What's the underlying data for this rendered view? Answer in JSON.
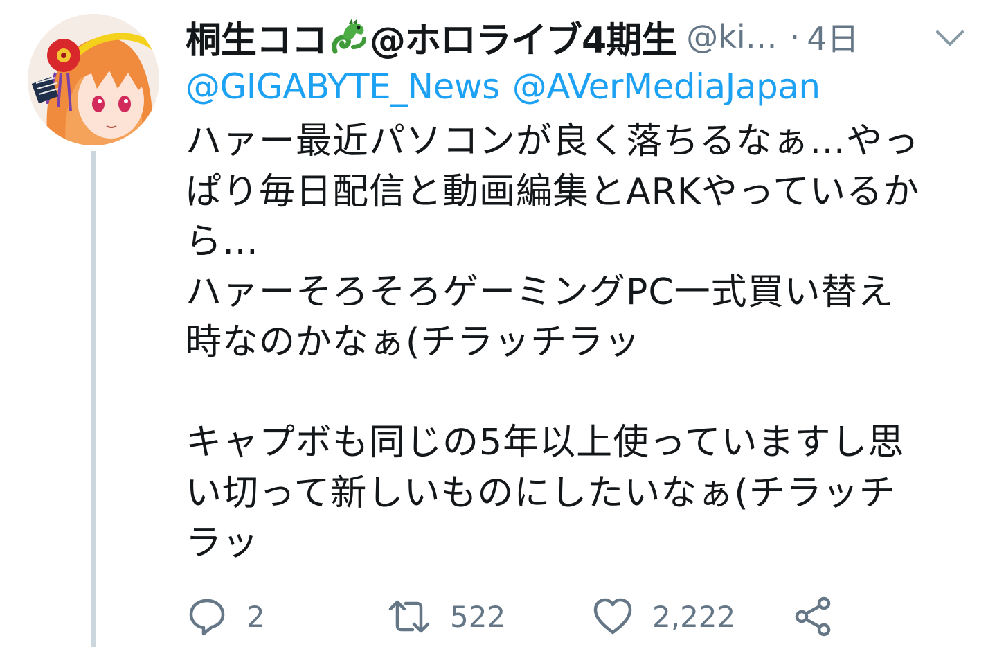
{
  "tweet": {
    "author": {
      "name_part1": "桐生ココ",
      "name_part2": "@ホロライブ4期生",
      "emoji_icon": "dragon-icon",
      "handle": "@ki…",
      "separator": "·",
      "time": "4日"
    },
    "reply_to": [
      "@GIGABYTE_News",
      "@AVerMediaJapan"
    ],
    "body_lines": [
      "ハァー最近パソコンが良く落ちるなぁ…やっ",
      "ぱり毎日配信と動画編集とARKやっているか",
      "ら…",
      "ハァーそろそろゲーミングPC一式買い替え",
      "時なのかなぁ(チラッチラッ",
      "",
      "キャプボも同じの5年以上使っていますし思",
      "い切って新しいものにしたいなぁ(チラッチ",
      "ラッ"
    ],
    "actions": {
      "reply_count": "2",
      "retweet_count": "522",
      "like_count": "2,222"
    },
    "colors": {
      "link": "#1da1f2",
      "secondary": "#657786",
      "text": "#14171a",
      "thread_line": "#ccd6dd"
    }
  }
}
